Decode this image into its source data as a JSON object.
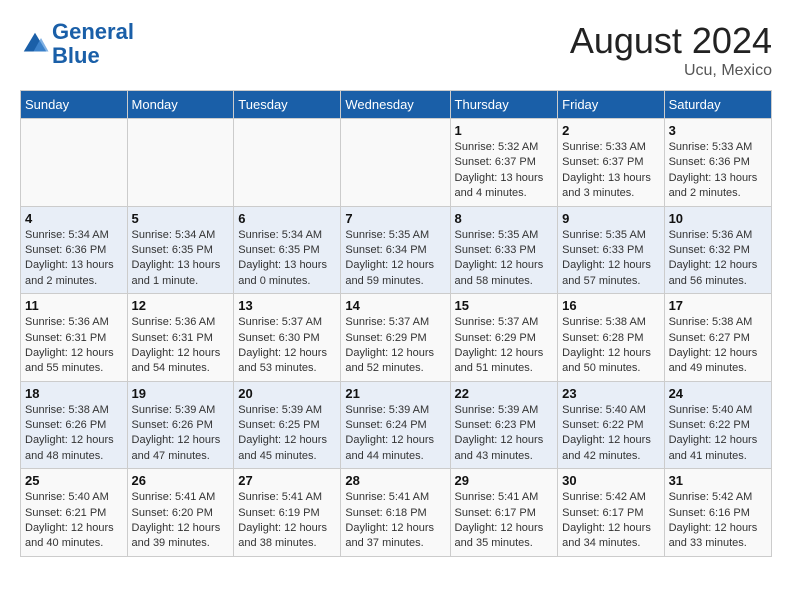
{
  "header": {
    "logo_line1": "General",
    "logo_line2": "Blue",
    "month_year": "August 2024",
    "location": "Ucu, Mexico"
  },
  "days_of_week": [
    "Sunday",
    "Monday",
    "Tuesday",
    "Wednesday",
    "Thursday",
    "Friday",
    "Saturday"
  ],
  "weeks": [
    [
      {
        "day": "",
        "detail": ""
      },
      {
        "day": "",
        "detail": ""
      },
      {
        "day": "",
        "detail": ""
      },
      {
        "day": "",
        "detail": ""
      },
      {
        "day": "1",
        "detail": "Sunrise: 5:32 AM\nSunset: 6:37 PM\nDaylight: 13 hours and 4 minutes."
      },
      {
        "day": "2",
        "detail": "Sunrise: 5:33 AM\nSunset: 6:37 PM\nDaylight: 13 hours and 3 minutes."
      },
      {
        "day": "3",
        "detail": "Sunrise: 5:33 AM\nSunset: 6:36 PM\nDaylight: 13 hours and 2 minutes."
      }
    ],
    [
      {
        "day": "4",
        "detail": "Sunrise: 5:34 AM\nSunset: 6:36 PM\nDaylight: 13 hours and 2 minutes."
      },
      {
        "day": "5",
        "detail": "Sunrise: 5:34 AM\nSunset: 6:35 PM\nDaylight: 13 hours and 1 minute."
      },
      {
        "day": "6",
        "detail": "Sunrise: 5:34 AM\nSunset: 6:35 PM\nDaylight: 13 hours and 0 minutes."
      },
      {
        "day": "7",
        "detail": "Sunrise: 5:35 AM\nSunset: 6:34 PM\nDaylight: 12 hours and 59 minutes."
      },
      {
        "day": "8",
        "detail": "Sunrise: 5:35 AM\nSunset: 6:33 PM\nDaylight: 12 hours and 58 minutes."
      },
      {
        "day": "9",
        "detail": "Sunrise: 5:35 AM\nSunset: 6:33 PM\nDaylight: 12 hours and 57 minutes."
      },
      {
        "day": "10",
        "detail": "Sunrise: 5:36 AM\nSunset: 6:32 PM\nDaylight: 12 hours and 56 minutes."
      }
    ],
    [
      {
        "day": "11",
        "detail": "Sunrise: 5:36 AM\nSunset: 6:31 PM\nDaylight: 12 hours and 55 minutes."
      },
      {
        "day": "12",
        "detail": "Sunrise: 5:36 AM\nSunset: 6:31 PM\nDaylight: 12 hours and 54 minutes."
      },
      {
        "day": "13",
        "detail": "Sunrise: 5:37 AM\nSunset: 6:30 PM\nDaylight: 12 hours and 53 minutes."
      },
      {
        "day": "14",
        "detail": "Sunrise: 5:37 AM\nSunset: 6:29 PM\nDaylight: 12 hours and 52 minutes."
      },
      {
        "day": "15",
        "detail": "Sunrise: 5:37 AM\nSunset: 6:29 PM\nDaylight: 12 hours and 51 minutes."
      },
      {
        "day": "16",
        "detail": "Sunrise: 5:38 AM\nSunset: 6:28 PM\nDaylight: 12 hours and 50 minutes."
      },
      {
        "day": "17",
        "detail": "Sunrise: 5:38 AM\nSunset: 6:27 PM\nDaylight: 12 hours and 49 minutes."
      }
    ],
    [
      {
        "day": "18",
        "detail": "Sunrise: 5:38 AM\nSunset: 6:26 PM\nDaylight: 12 hours and 48 minutes."
      },
      {
        "day": "19",
        "detail": "Sunrise: 5:39 AM\nSunset: 6:26 PM\nDaylight: 12 hours and 47 minutes."
      },
      {
        "day": "20",
        "detail": "Sunrise: 5:39 AM\nSunset: 6:25 PM\nDaylight: 12 hours and 45 minutes."
      },
      {
        "day": "21",
        "detail": "Sunrise: 5:39 AM\nSunset: 6:24 PM\nDaylight: 12 hours and 44 minutes."
      },
      {
        "day": "22",
        "detail": "Sunrise: 5:39 AM\nSunset: 6:23 PM\nDaylight: 12 hours and 43 minutes."
      },
      {
        "day": "23",
        "detail": "Sunrise: 5:40 AM\nSunset: 6:22 PM\nDaylight: 12 hours and 42 minutes."
      },
      {
        "day": "24",
        "detail": "Sunrise: 5:40 AM\nSunset: 6:22 PM\nDaylight: 12 hours and 41 minutes."
      }
    ],
    [
      {
        "day": "25",
        "detail": "Sunrise: 5:40 AM\nSunset: 6:21 PM\nDaylight: 12 hours and 40 minutes."
      },
      {
        "day": "26",
        "detail": "Sunrise: 5:41 AM\nSunset: 6:20 PM\nDaylight: 12 hours and 39 minutes."
      },
      {
        "day": "27",
        "detail": "Sunrise: 5:41 AM\nSunset: 6:19 PM\nDaylight: 12 hours and 38 minutes."
      },
      {
        "day": "28",
        "detail": "Sunrise: 5:41 AM\nSunset: 6:18 PM\nDaylight: 12 hours and 37 minutes."
      },
      {
        "day": "29",
        "detail": "Sunrise: 5:41 AM\nSunset: 6:17 PM\nDaylight: 12 hours and 35 minutes."
      },
      {
        "day": "30",
        "detail": "Sunrise: 5:42 AM\nSunset: 6:17 PM\nDaylight: 12 hours and 34 minutes."
      },
      {
        "day": "31",
        "detail": "Sunrise: 5:42 AM\nSunset: 6:16 PM\nDaylight: 12 hours and 33 minutes."
      }
    ]
  ]
}
